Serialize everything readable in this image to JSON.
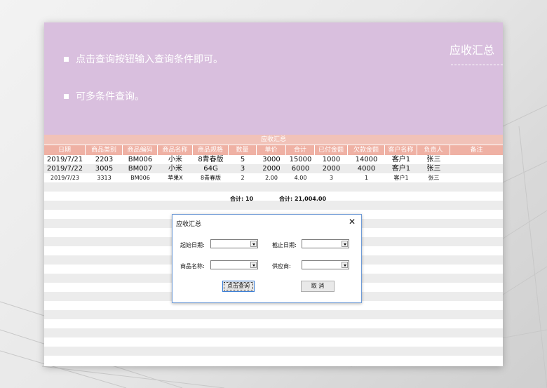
{
  "banner": {
    "tips": [
      "点击查询按钮输入查询条件即可。",
      "可多条件查询。"
    ],
    "title": "应收汇总"
  },
  "table": {
    "title": "应收汇总",
    "headers": [
      "日期",
      "商品类别",
      "商品编码",
      "商品名称",
      "商品规格",
      "数量",
      "单价",
      "合计",
      "已付金额",
      "欠款金额",
      "客户名称",
      "负责人",
      "备注"
    ],
    "rows": [
      [
        "2019/7/21",
        "2203",
        "BM006",
        "小米",
        "8青春版",
        "5",
        "3000",
        "15000",
        "1000",
        "14000",
        "客户1",
        "张三",
        ""
      ],
      [
        "2019/7/22",
        "3005",
        "BM007",
        "小米",
        "64G",
        "3",
        "2000",
        "6000",
        "2000",
        "4000",
        "客户1",
        "张三",
        ""
      ],
      [
        "2019/7/23",
        "3313",
        "BM006",
        "苹果X",
        "8青春版",
        "2",
        "2.00",
        "4.00",
        "3",
        "1",
        "客户1",
        "张三",
        ""
      ]
    ],
    "totals": {
      "qty": "合计: 10",
      "amount": "合计: 21,004.00"
    }
  },
  "dialog": {
    "title": "应收汇总",
    "close": "✕",
    "start_date_label": "起始日期:",
    "end_date_label": "截止日期:",
    "product_name_label": "商品名称:",
    "supplier_label": "供应商:",
    "start_date_value": "",
    "end_date_value": "",
    "product_name_value": "",
    "supplier_value": "",
    "query_button": "点击查询",
    "cancel_button": "取 消"
  },
  "colors": {
    "banner": "#d9bfde",
    "header": "#efb1a4",
    "title_bar": "#f1c2b8",
    "dialog_border": "#6f9bd6"
  }
}
